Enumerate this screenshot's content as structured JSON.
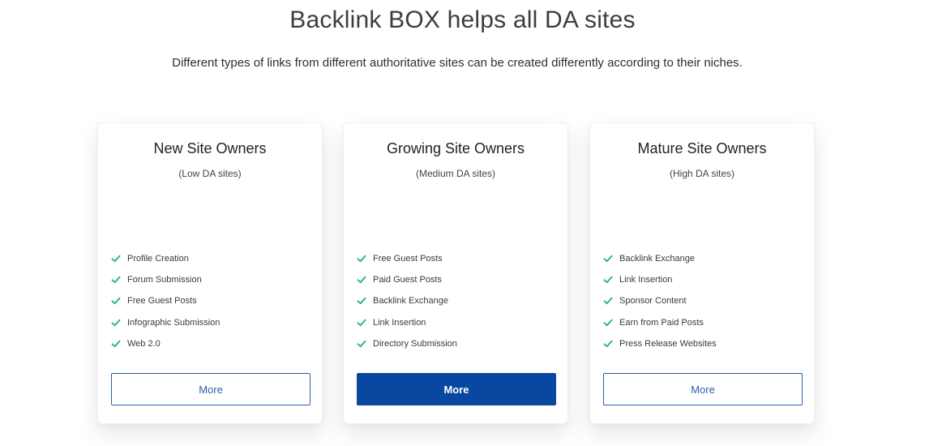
{
  "header": {
    "title": "Backlink BOX helps all DA sites",
    "subtitle": "Different types of links from different authoritative sites can be created differently according to their niches."
  },
  "colors": {
    "accent": "#0a47a0",
    "check": "#2bb673"
  },
  "cards": [
    {
      "title": "New Site Owners",
      "subtitle": "(Low DA sites)",
      "features": [
        "Profile Creation",
        "Forum Submission",
        "Free Guest Posts",
        "Infographic Submission",
        "Web 2.0"
      ],
      "button_label": "More",
      "button_style": "outline"
    },
    {
      "title": "Growing Site Owners",
      "subtitle": "(Medium DA sites)",
      "features": [
        "Free Guest Posts",
        "Paid Guest Posts",
        "Backlink Exchange",
        "Link Insertion",
        "Directory Submission"
      ],
      "button_label": "More",
      "button_style": "filled"
    },
    {
      "title": "Mature Site Owners",
      "subtitle": "(High DA sites)",
      "features": [
        "Backlink Exchange",
        "Link Insertion",
        "Sponsor Content",
        "Earn from Paid Posts",
        "Press Release Websites"
      ],
      "button_label": "More",
      "button_style": "outline"
    }
  ]
}
